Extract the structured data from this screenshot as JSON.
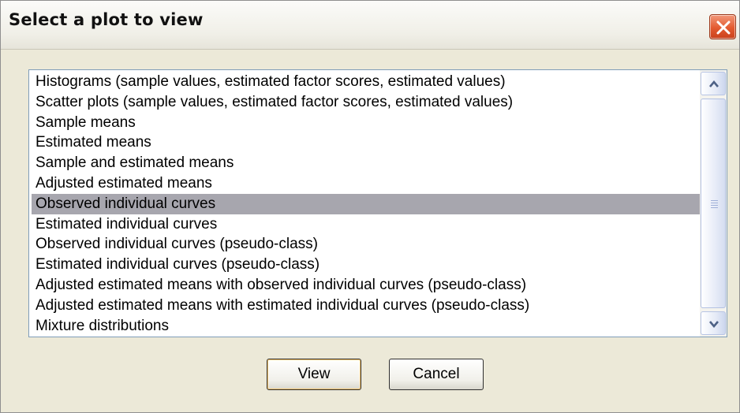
{
  "dialog": {
    "title": "Select a plot to view",
    "close_icon": "close-x-icon"
  },
  "list": {
    "items": [
      "Histograms (sample values, estimated factor scores, estimated values)",
      "Scatter plots (sample values, estimated factor scores, estimated values)",
      "Sample means",
      "Estimated means",
      "Sample and estimated means",
      "Adjusted estimated means",
      "Observed individual curves",
      "Estimated individual curves",
      "Observed individual curves (pseudo-class)",
      "Estimated individual curves (pseudo-class)",
      "Adjusted estimated means with observed individual curves (pseudo-class)",
      "Adjusted estimated means with estimated individual curves (pseudo-class)",
      "Mixture distributions"
    ],
    "selected_index": 6
  },
  "scrollbar": {
    "up_icon": "chevron-up-icon",
    "down_icon": "chevron-down-icon"
  },
  "buttons": {
    "view": "View",
    "cancel": "Cancel"
  },
  "colors": {
    "dialog_bg": "#ece9d8",
    "selection": "#a7a6ae",
    "close_button": "#e35a2f"
  }
}
